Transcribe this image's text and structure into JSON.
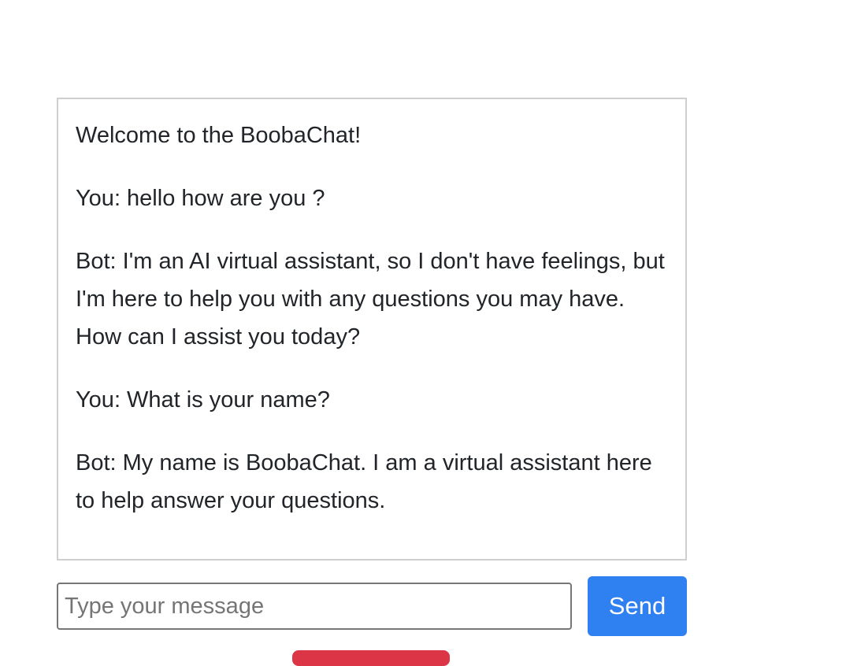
{
  "chat": {
    "messages": [
      {
        "text": "Welcome to the BoobaChat!"
      },
      {
        "text": "You: hello how are you ?"
      },
      {
        "text": "Bot: I'm an AI virtual assistant, so I don't have feelings, but I'm here to help you with any questions you may have. How can I assist you today?"
      },
      {
        "text": "You: What is your name?"
      },
      {
        "text": "Bot: My name is BoobaChat. I am a virtual assistant here to help answer your questions."
      }
    ]
  },
  "composer": {
    "placeholder": "Type your message",
    "value": "",
    "send_label": "Send"
  },
  "colors": {
    "send_button": "#2f80f0",
    "secondary_button": "#dc3545",
    "chat_border": "#cfcfcf"
  }
}
